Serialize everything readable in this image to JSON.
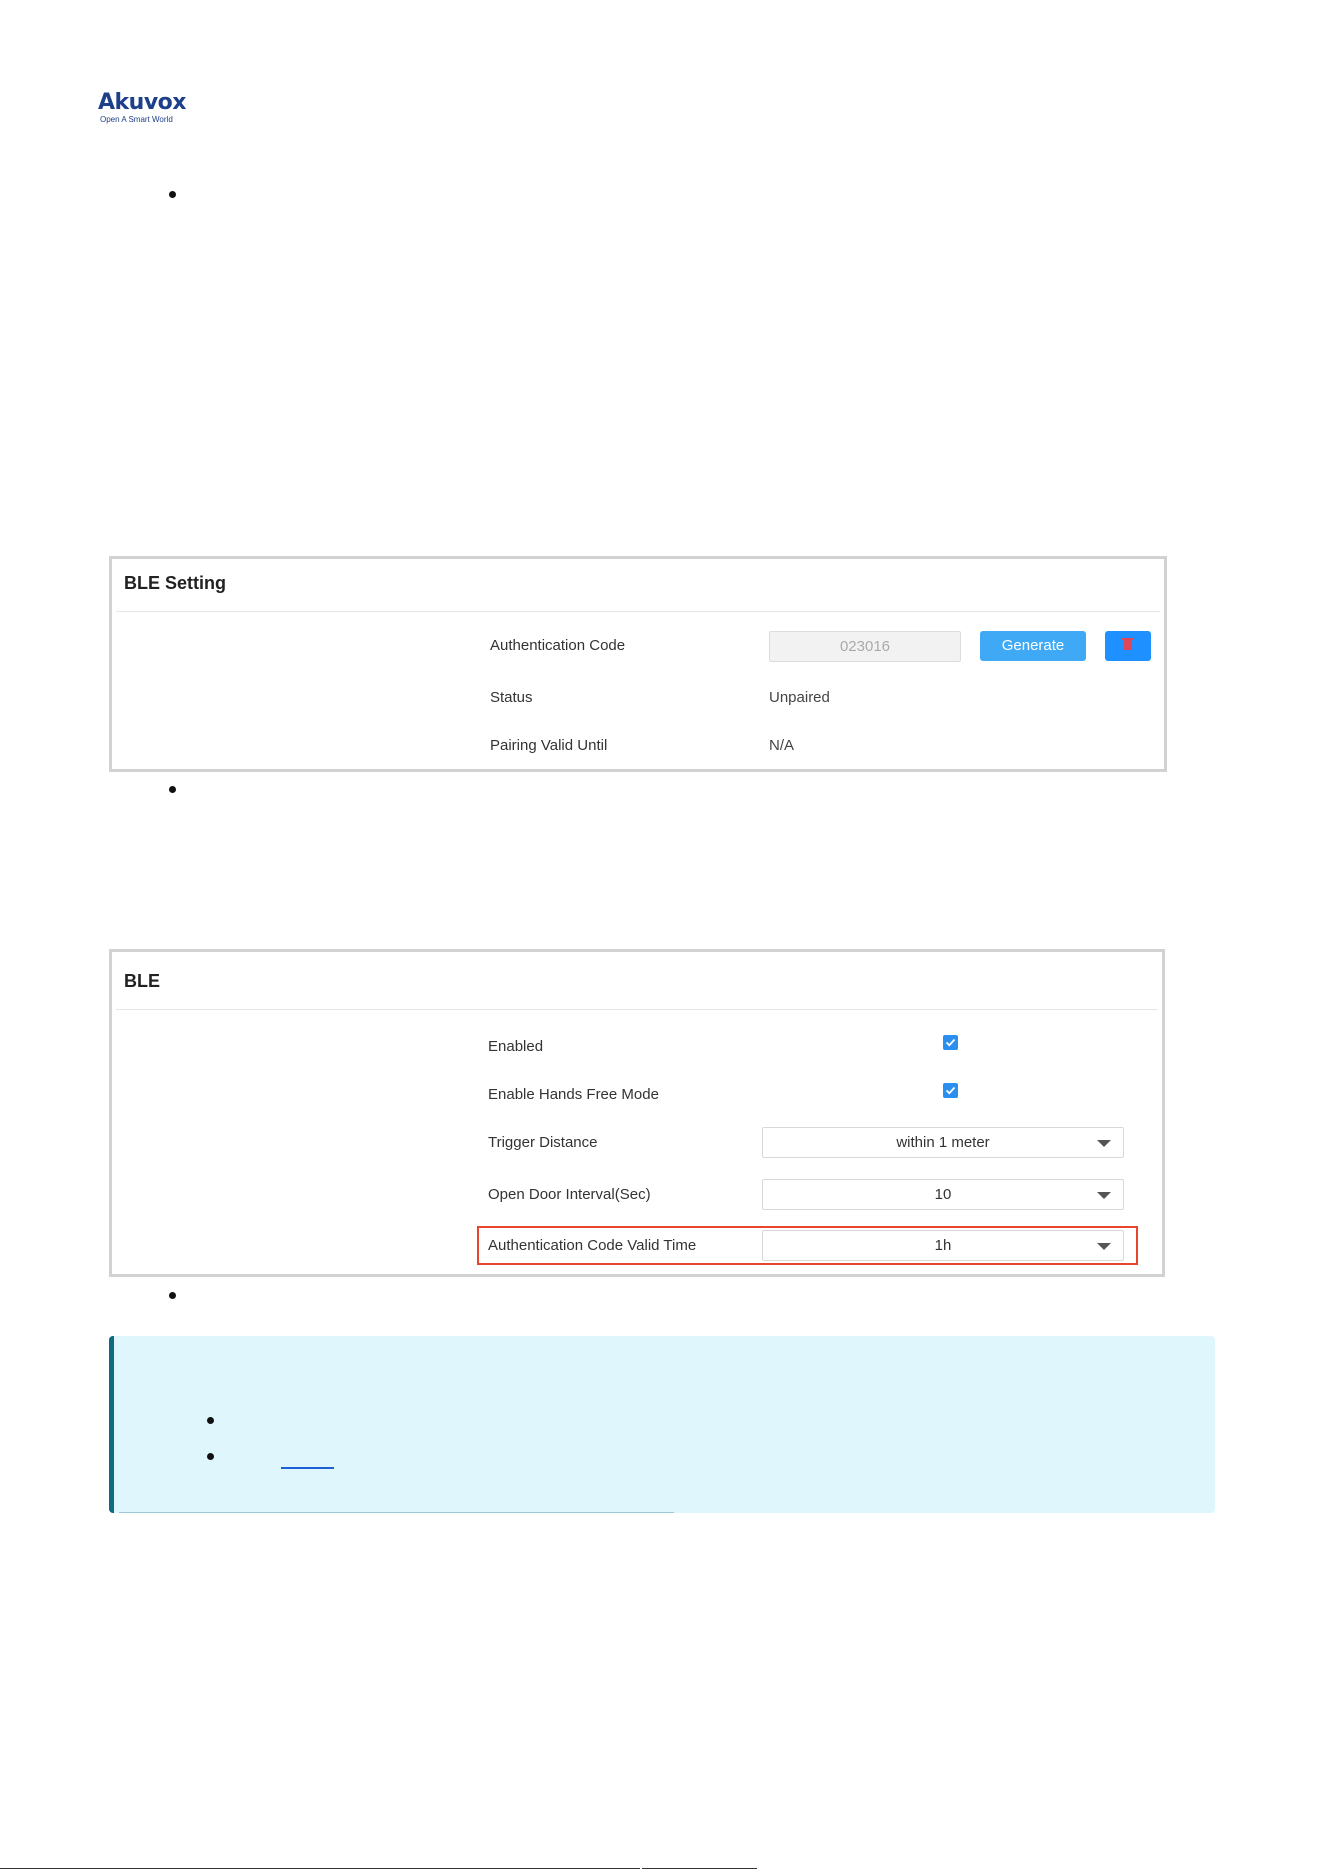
{
  "brand": {
    "name": "Akuvox",
    "tagline": "Open A Smart World"
  },
  "ble_setting": {
    "title": "BLE Setting",
    "auth_code_label": "Authentication Code",
    "auth_code_value": "023016",
    "generate_label": "Generate",
    "status_label": "Status",
    "status_value": "Unpaired",
    "pairing_label": "Pairing Valid Until",
    "pairing_value": "N/A"
  },
  "ble": {
    "title": "BLE",
    "enabled_label": "Enabled",
    "enabled_checked": true,
    "hands_free_label": "Enable Hands Free Mode",
    "hands_free_checked": true,
    "trigger_label": "Trigger Distance",
    "trigger_value": "within 1 meter",
    "interval_label": "Open Door Interval(Sec)",
    "interval_value": "10",
    "valid_time_label": "Authentication Code Valid Time",
    "valid_time_value": "1h"
  },
  "colors": {
    "accent": "#3fa9f5",
    "checkbox": "#2b8ff0",
    "highlight": "#e8452f",
    "note_bg": "#e0f6fd",
    "note_bar": "#0f6b82",
    "brand": "#1e3f8a"
  }
}
